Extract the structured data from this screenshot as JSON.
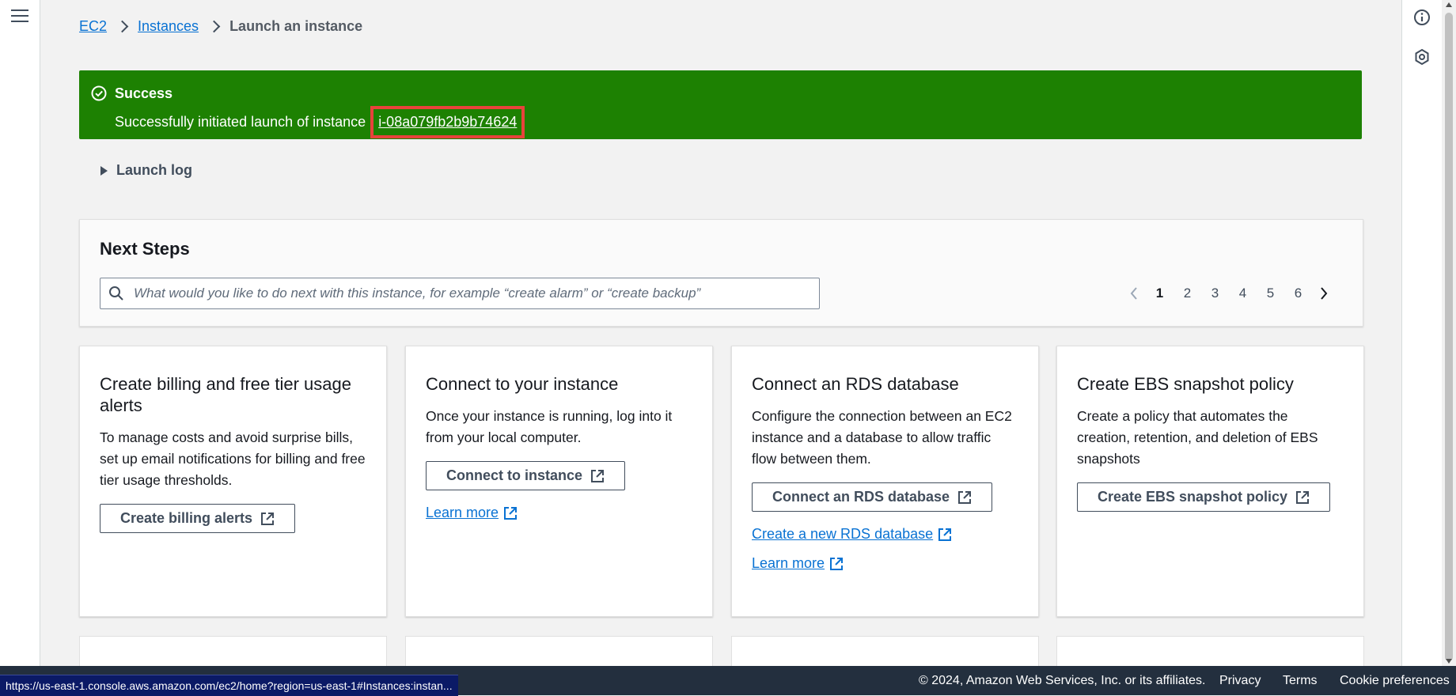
{
  "breadcrumb": {
    "items": [
      "EC2",
      "Instances"
    ],
    "current": "Launch an instance"
  },
  "flash": {
    "title": "Success",
    "message": "Successfully initiated launch of instance",
    "instance_id": "i-08a079fb2b9b74624",
    "color": "#1d8102"
  },
  "launch_log": {
    "label": "Launch log"
  },
  "next_steps": {
    "title": "Next Steps",
    "search_placeholder": "What would you like to do next with this instance, for example “create alarm” or “create backup”",
    "pages": [
      "1",
      "2",
      "3",
      "4",
      "5",
      "6"
    ],
    "current_page": "1"
  },
  "cards": [
    {
      "title": "Create billing and free tier usage alerts",
      "desc": "To manage costs and avoid surprise bills, set up email notifications for billing and free tier usage thresholds.",
      "button": "Create billing alerts"
    },
    {
      "title": "Connect to your instance",
      "desc": "Once your instance is running, log into it from your local computer.",
      "button": "Connect to instance",
      "link1": "Learn more"
    },
    {
      "title": "Connect an RDS database",
      "desc": "Configure the connection between an EC2 instance and a database to allow traffic flow between them.",
      "button": "Connect an RDS database",
      "link1": "Create a new RDS database",
      "link2": "Learn more"
    },
    {
      "title": "Create EBS snapshot policy",
      "desc": "Create a policy that automates the creation, retention, and deletion of EBS snapshots",
      "button": "Create EBS snapshot policy"
    }
  ],
  "footer": {
    "copyright": "© 2024, Amazon Web Services, Inc. or its affiliates.",
    "links": [
      "Privacy",
      "Terms",
      "Cookie preferences"
    ]
  },
  "status_url": "https://us-east-1.console.aws.amazon.com/ec2/home?region=us-east-1#Instances:instan..."
}
